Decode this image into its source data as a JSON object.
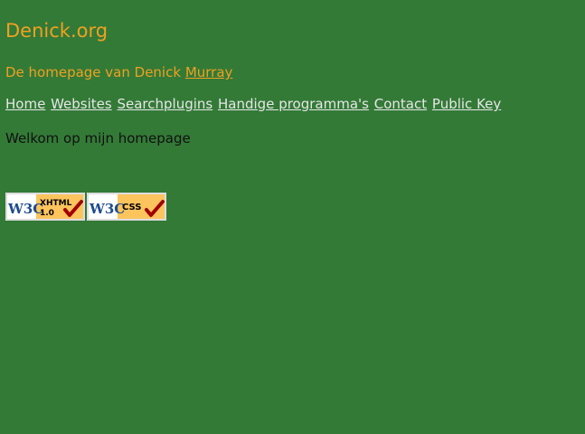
{
  "site": {
    "title": "Denick.org",
    "subtitle_prefix": "De homepage van Denick ",
    "subtitle_link": "Murray"
  },
  "nav": {
    "items": [
      "Home",
      "Websites",
      "Searchplugins",
      "Handige programma's",
      "Contact",
      "Public Key"
    ]
  },
  "content": {
    "welcome": "Welkom op mijn homepage"
  },
  "badges": {
    "xhtml": {
      "brand": "W3C",
      "label_line1": "XHTML",
      "label_line2": "1.0"
    },
    "css": {
      "brand": "W3C",
      "label": "CSS"
    }
  },
  "colors": {
    "background": "#337a37",
    "title": "#f0a020",
    "nav_link": "#e6e6e6",
    "text": "#111111"
  }
}
